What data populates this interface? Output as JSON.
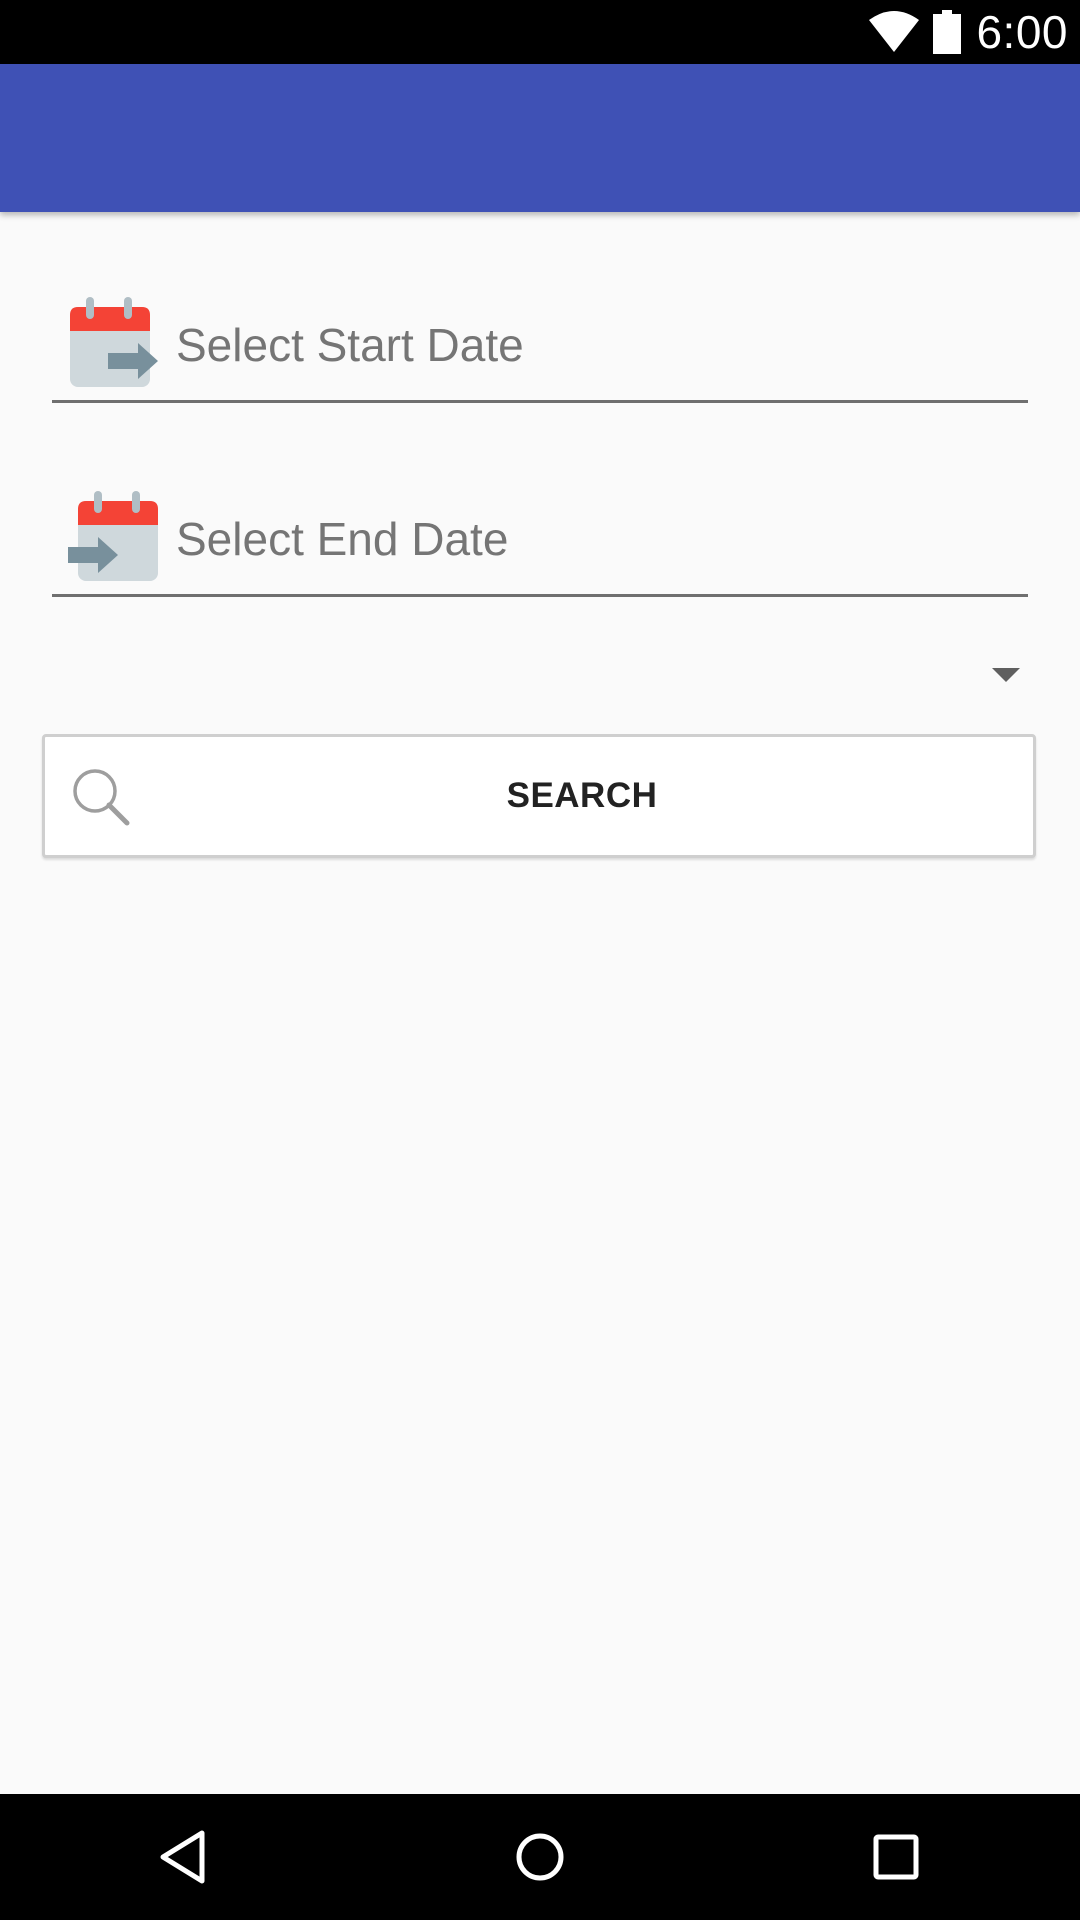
{
  "status_bar": {
    "time": "6:00",
    "icons": [
      "wifi-icon",
      "battery-icon"
    ]
  },
  "app_bar": {
    "title": "",
    "color": "#3f51b5"
  },
  "form": {
    "start_date": {
      "placeholder": "Select Start Date",
      "icon": "calendar-arrow-right-icon"
    },
    "end_date": {
      "placeholder": "Select End Date",
      "icon": "calendar-arrow-left-icon"
    },
    "spinner": {
      "selected": "",
      "icon": "dropdown-arrow-icon"
    },
    "search_button": {
      "label": "SEARCH",
      "icon": "search-icon"
    }
  },
  "nav_bar": {
    "buttons": [
      "back-icon",
      "home-icon",
      "recents-icon"
    ]
  },
  "colors": {
    "primary": "#3f51b5",
    "background": "#fafafa",
    "calendar_red": "#f44336",
    "calendar_gray": "#cfd8dc",
    "arrow_gray": "#78909c"
  }
}
